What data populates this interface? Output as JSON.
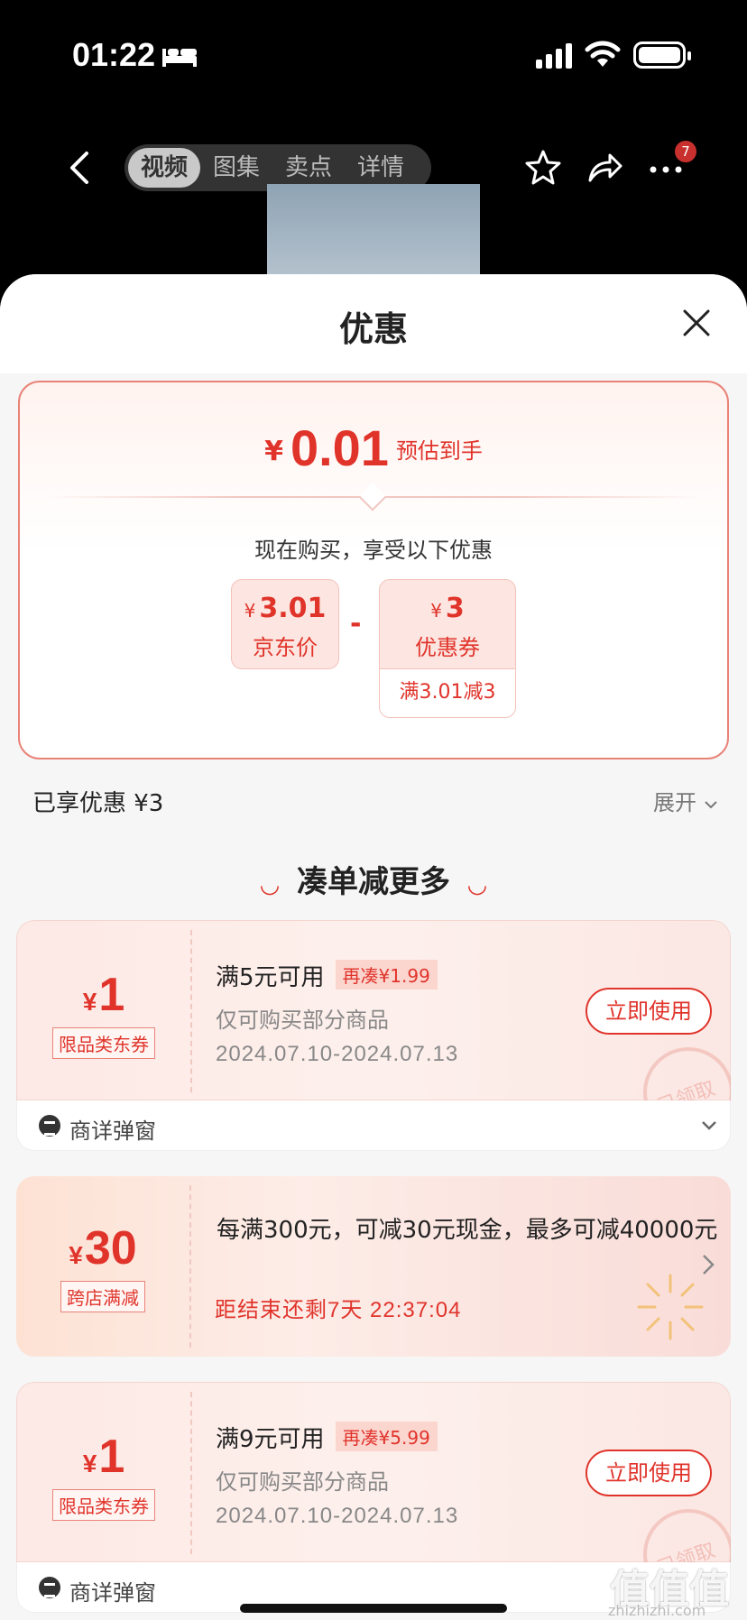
{
  "status_bar": {
    "time": "01:22"
  },
  "nav": {
    "tabs": [
      "视频",
      "图集",
      "卖点",
      "详情"
    ],
    "active_tab": "视频",
    "badge_count": "7"
  },
  "sheet": {
    "title": "优惠",
    "summary": {
      "currency": "¥",
      "final_price": "0.01",
      "final_label": "预估到手",
      "subtitle": "现在购买，享受以下优惠",
      "jd_price": {
        "currency": "¥",
        "value": "3.01",
        "label": "京东价"
      },
      "minus": "-",
      "coupon": {
        "currency": "¥",
        "value": "3",
        "label": "优惠券",
        "rule": "满3.01减3"
      }
    },
    "enjoyed": "已享优惠 ¥3",
    "expand_label": "展开",
    "more_title": "凑单减更多",
    "coupons": [
      {
        "currency": "¥",
        "amount": "1",
        "tag": "限品类东券",
        "condition": "满5元可用",
        "need_more": "再凑¥1.99",
        "scope": "仅可购买部分商品",
        "validity": "2024.07.10-2024.07.13",
        "use_label": "立即使用",
        "stamp": "已领取",
        "footer": "商详弹窗"
      },
      {
        "currency": "¥",
        "amount": "1",
        "tag": "限品类东券",
        "condition": "满9元可用",
        "need_more": "再凑¥5.99",
        "scope": "仅可购买部分商品",
        "validity": "2024.07.10-2024.07.13",
        "use_label": "立即使用",
        "stamp": "已领取",
        "footer": "商详弹窗"
      }
    ],
    "promo": {
      "currency": "¥",
      "amount": "30",
      "tag": "跨店满减",
      "description": "每满300元，可减30元现金，最多可减40000元",
      "countdown": "距结束还剩7天 22:37:04"
    }
  },
  "watermark": {
    "text": "值值值",
    "url": "zhizhizhi.com"
  },
  "colors": {
    "accent": "#e0342b",
    "sheet_bg": "#f6f6f6",
    "card_bg": "#fde9e5"
  }
}
